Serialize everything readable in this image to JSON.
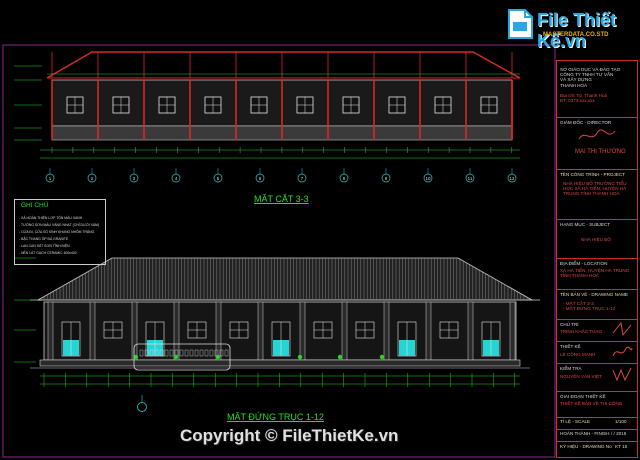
{
  "watermark": {
    "brand": "File Thiết Kế.vn",
    "domain": "MASTERDATA.CO.STD",
    "copyright": "Copyright © FileThietKe.vn"
  },
  "drawing": {
    "section_title": "MẶT CẮT 3-3",
    "elevation_title": "MẶT ĐỨNG TRỤC 1-12",
    "axis_labels": [
      "1",
      "2",
      "3",
      "4",
      "5",
      "6",
      "7",
      "8",
      "9",
      "10",
      "11",
      "12"
    ],
    "notes": {
      "title": "GHI CHÚ",
      "lines": [
        "- XÂ HOÀN THIỆN LỢP TÔN MÀU XANH",
        "- TƯỜNG SƠN MÀU VÀNG NHẠT (CHỈ DƯỚI XÁM)",
        "- CỬA ĐI, CỬA SỔ KÍNH KHUNG NHÔM TRẮNG",
        "- BẬC THANG ỐP ĐÁ GRANITE",
        "- LAN CAN SẮT SƠN TĨNH ĐIỆN",
        "- NỀN LÁT GẠCH CERAMIC 400x400"
      ]
    }
  },
  "title_block": {
    "company_lines": "SỞ GIÁO DỤC VÀ ĐÀO TẠO\nCÔNG TY TNHH TƯ VẤN\nVÀ XÂY DỰNG\nTHANH HOÁ",
    "address_lines": "Địa chỉ: Tp. Thanh Hoá\nĐT: 0373.xxx.xxx",
    "director_label": "GIÁM ĐỐC - DIRECTOR",
    "director_name": "MAI THỊ THƯƠNG",
    "project_label": "TÊN CÔNG TRÌNH - PROJECT",
    "project_value": "NHÀ HIỆU BỘ TRƯỜNG TIỂU\nHỌC XÃ HÀ TIẾN, HUYỆN HÀ\nTRUNG TỈNH THANH HOÁ",
    "item_label": "HẠNG MỤC - SUBJECT",
    "item_value": "NHÀ HIỆU BỘ",
    "location_label": "ĐỊA ĐIỂM - LOCATION",
    "location_value": "XÃ HÀ TIẾN, HUYỆN HÀ TRUNG\nTỈNH THANH HOÁ",
    "drawing_label": "TÊN BẢN VẼ - DRAWING NAME",
    "drawing_value": "- MẶT CẮT 3-3\n- MẶT ĐỨNG TRỤC 1-12",
    "lead_label": "CHỦ TRÌ",
    "lead_name": "TRỊNH KHẮC THAO",
    "design_label": "THIẾT KẾ",
    "design_name": "LÊ CÔNG MẠNH",
    "check_label": "KIỂM TRA",
    "check_name": "NGUYỄN VĂN VIỆT",
    "stage_label": "GIAI ĐOẠN THIẾT KẾ",
    "stage_value": "THIẾT KẾ BẢN VẼ THI CÔNG",
    "scale_label": "TỈ LỆ - SCALE",
    "scale_value": "1/100",
    "date_label": "HOÀN THÀNH - FINISH",
    "date_value": "/ / 2016",
    "sheet_label": "KÝ HIỆU - DRAWING No",
    "sheet_value": "KT 15"
  },
  "colors": {
    "background": "#000000",
    "roof_red": "#d82828",
    "wall_grey": "#b0b0b0",
    "dim_green": "#2ad22a",
    "axis_cyan": "#29c9c9",
    "window_cyan": "#25d4d4"
  }
}
